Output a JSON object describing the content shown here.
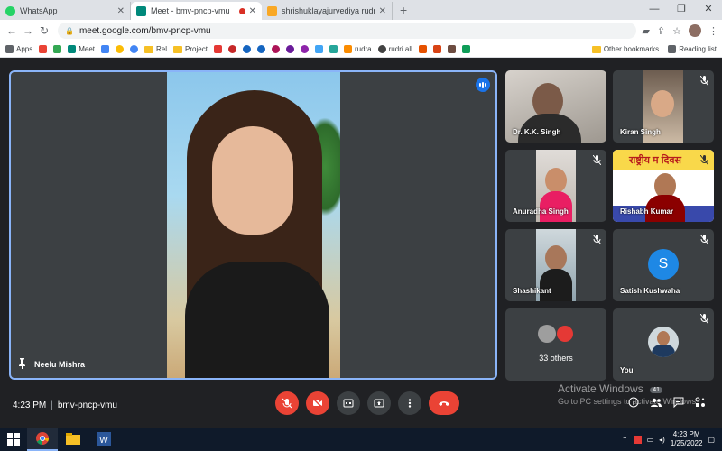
{
  "browser": {
    "tabs": [
      {
        "title": "WhatsApp",
        "color": "#25d366"
      },
      {
        "title": "Meet - bmv-pncp-vmu",
        "color": "#00897b"
      },
      {
        "title": "shrishuklayajurvediya rudrAShTAdhyAyi",
        "color": "#f9a825"
      }
    ],
    "new_tab": "+",
    "url": "meet.google.com/bmv-pncp-vmu",
    "bookmarks": [
      "Apps",
      "Meet",
      "Rel",
      "Project",
      "rudra",
      "rudri all"
    ],
    "other_bookmarks": "Other bookmarks",
    "reading_list": "Reading list"
  },
  "meet": {
    "main_participant": "Neelu Mishra",
    "participants": [
      {
        "name": "Dr. K.K. Singh",
        "muted": false
      },
      {
        "name": "Kiran Singh",
        "muted": true
      },
      {
        "name": "Anuradha Singh",
        "muted": true
      },
      {
        "name": "Rishabh Kumar",
        "muted": true
      },
      {
        "name": "Shashikant",
        "muted": true
      },
      {
        "name": "Satish Kushwaha",
        "muted": true,
        "initial": "S"
      },
      {
        "name": "You",
        "muted": true
      }
    ],
    "others_label": "33 others",
    "banner_text": "राष्ट्रीय म  दिवस",
    "time": "4:23 PM",
    "meeting_code": "bmv-pncp-vmu",
    "people_count": "41"
  },
  "windows": {
    "activate_title": "Activate Windows",
    "activate_sub": "Go to PC settings to activate Windows.",
    "clock_time": "4:23 PM",
    "clock_date": "1/25/2022"
  }
}
